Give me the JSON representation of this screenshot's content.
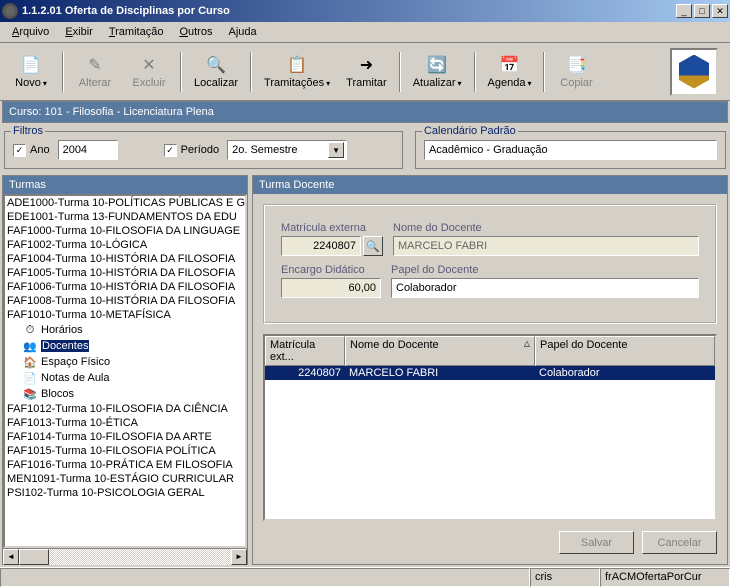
{
  "titlebar": {
    "title": "1.1.2.01 Oferta de Disciplinas por Curso"
  },
  "menus": {
    "arquivo": "Arquivo",
    "exibir": "Exibir",
    "tramitacao": "Tramitação",
    "outros": "Outros",
    "ajuda": "Ajuda"
  },
  "toolbar": {
    "novo": "Novo",
    "alterar": "Alterar",
    "excluir": "Excluir",
    "localizar": "Localizar",
    "tramitacoes": "Tramitações",
    "tramitar": "Tramitar",
    "atualizar": "Atualizar",
    "agenda": "Agenda",
    "copiar": "Copiar"
  },
  "curso": "Curso: 101 - Filosofia - Licenciatura Plena",
  "filtros": {
    "legend": "Filtros",
    "ano_label": "Ano",
    "ano_value": "2004",
    "periodo_label": "Período",
    "periodo_value": "2o. Semestre"
  },
  "calendario": {
    "legend": "Calendário Padrão",
    "value": "Acadêmico - Graduação"
  },
  "turmas": {
    "header": "Turmas",
    "items": [
      "ADE1000-Turma 10-POLÍTICAS PÚBLICAS E G",
      "EDE1001-Turma 13-FUNDAMENTOS DA EDU",
      "FAF1000-Turma 10-FILOSOFIA DA LINGUAGE",
      "FAF1002-Turma 10-LÓGICA",
      "FAF1004-Turma 10-HISTÓRIA DA FILOSOFIA",
      "FAF1005-Turma 10-HISTÓRIA DA FILOSOFIA",
      "FAF1006-Turma 10-HISTÓRIA DA FILOSOFIA",
      "FAF1008-Turma 10-HISTÓRIA DA FILOSOFIA",
      "FAF1010-Turma 10-METAFÍSICA"
    ],
    "subitems": [
      {
        "icon": "⏱",
        "label": "Horários"
      },
      {
        "icon": "👥",
        "label": "Docentes"
      },
      {
        "icon": "🏠",
        "label": "Espaço Físico"
      },
      {
        "icon": "📄",
        "label": "Notas de Aula"
      },
      {
        "icon": "📚",
        "label": "Blocos"
      }
    ],
    "items2": [
      "FAF1012-Turma 10-FILOSOFIA DA CIÊNCIA",
      "FAF1013-Turma 10-ÉTICA",
      "FAF1014-Turma 10-FILOSOFIA DA ARTE",
      "FAF1015-Turma 10-FILOSOFIA POLÍTICA",
      "FAF1016-Turma 10-PRÁTICA EM FILOSOFIA",
      "MEN1091-Turma 10-ESTÁGIO CURRICULAR",
      "PSI102-Turma 10-PSICOLOGIA GERAL"
    ]
  },
  "docente_panel": {
    "header": "Turma Docente",
    "matricula_label": "Matrícula externa",
    "matricula_value": "2240807",
    "nome_label": "Nome do Docente",
    "nome_value": "MARCELO FABRI",
    "encargo_label": "Encargo Didático",
    "encargo_value": "60,00",
    "papel_label": "Papel do Docente",
    "papel_value": "Colaborador"
  },
  "grid": {
    "cols": [
      "Matrícula ext...",
      "Nome do Docente",
      "Papel do Docente"
    ],
    "row": {
      "matricula": "2240807",
      "nome": "MARCELO FABRI",
      "papel": "Colaborador"
    }
  },
  "buttons": {
    "salvar": "Salvar",
    "cancelar": "Cancelar"
  },
  "status": {
    "user": "cris",
    "form": "frACMOfertaPorCur"
  }
}
